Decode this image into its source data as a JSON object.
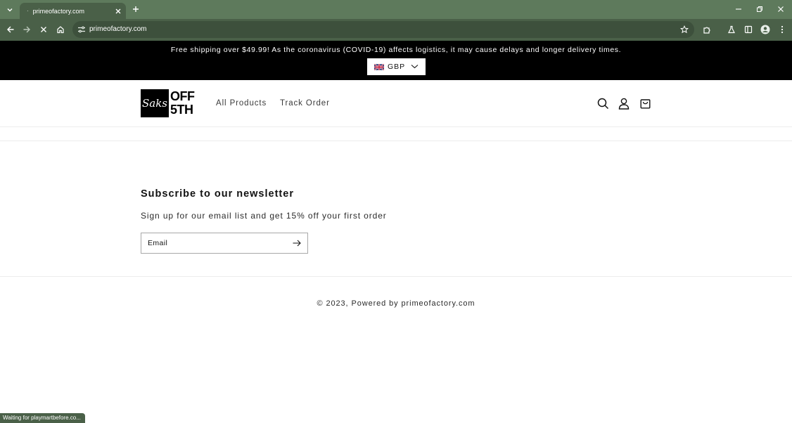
{
  "browser": {
    "tab": {
      "title": "primeofactory.com"
    },
    "omnibox": {
      "url": "primeofactory.com"
    },
    "status_text": "Waiting for playmartbefore.co..."
  },
  "announcement": {
    "text": "Free shipping over $49.99! As the coronavirus (COVID-19) affects logistics, it may cause delays and longer delivery times.",
    "currency": "GBP"
  },
  "header": {
    "logo": {
      "left": "Saks",
      "line1": "OFF",
      "line2": "5TH"
    },
    "nav": [
      {
        "label": "All Products"
      },
      {
        "label": "Track Order"
      }
    ]
  },
  "newsletter": {
    "heading": "Subscribe to our newsletter",
    "subheading": "Sign up for our email list and get 15% off your first order",
    "email_placeholder": "Email",
    "email_value": ""
  },
  "footer": {
    "copyright": "© 2023,",
    "powered": "Powered by primeofactory.com"
  },
  "colors": {
    "chrome_dark": "#4a6048",
    "chrome_light": "#5e7a5c",
    "announcement_bg": "#000000",
    "text": "#121212"
  }
}
